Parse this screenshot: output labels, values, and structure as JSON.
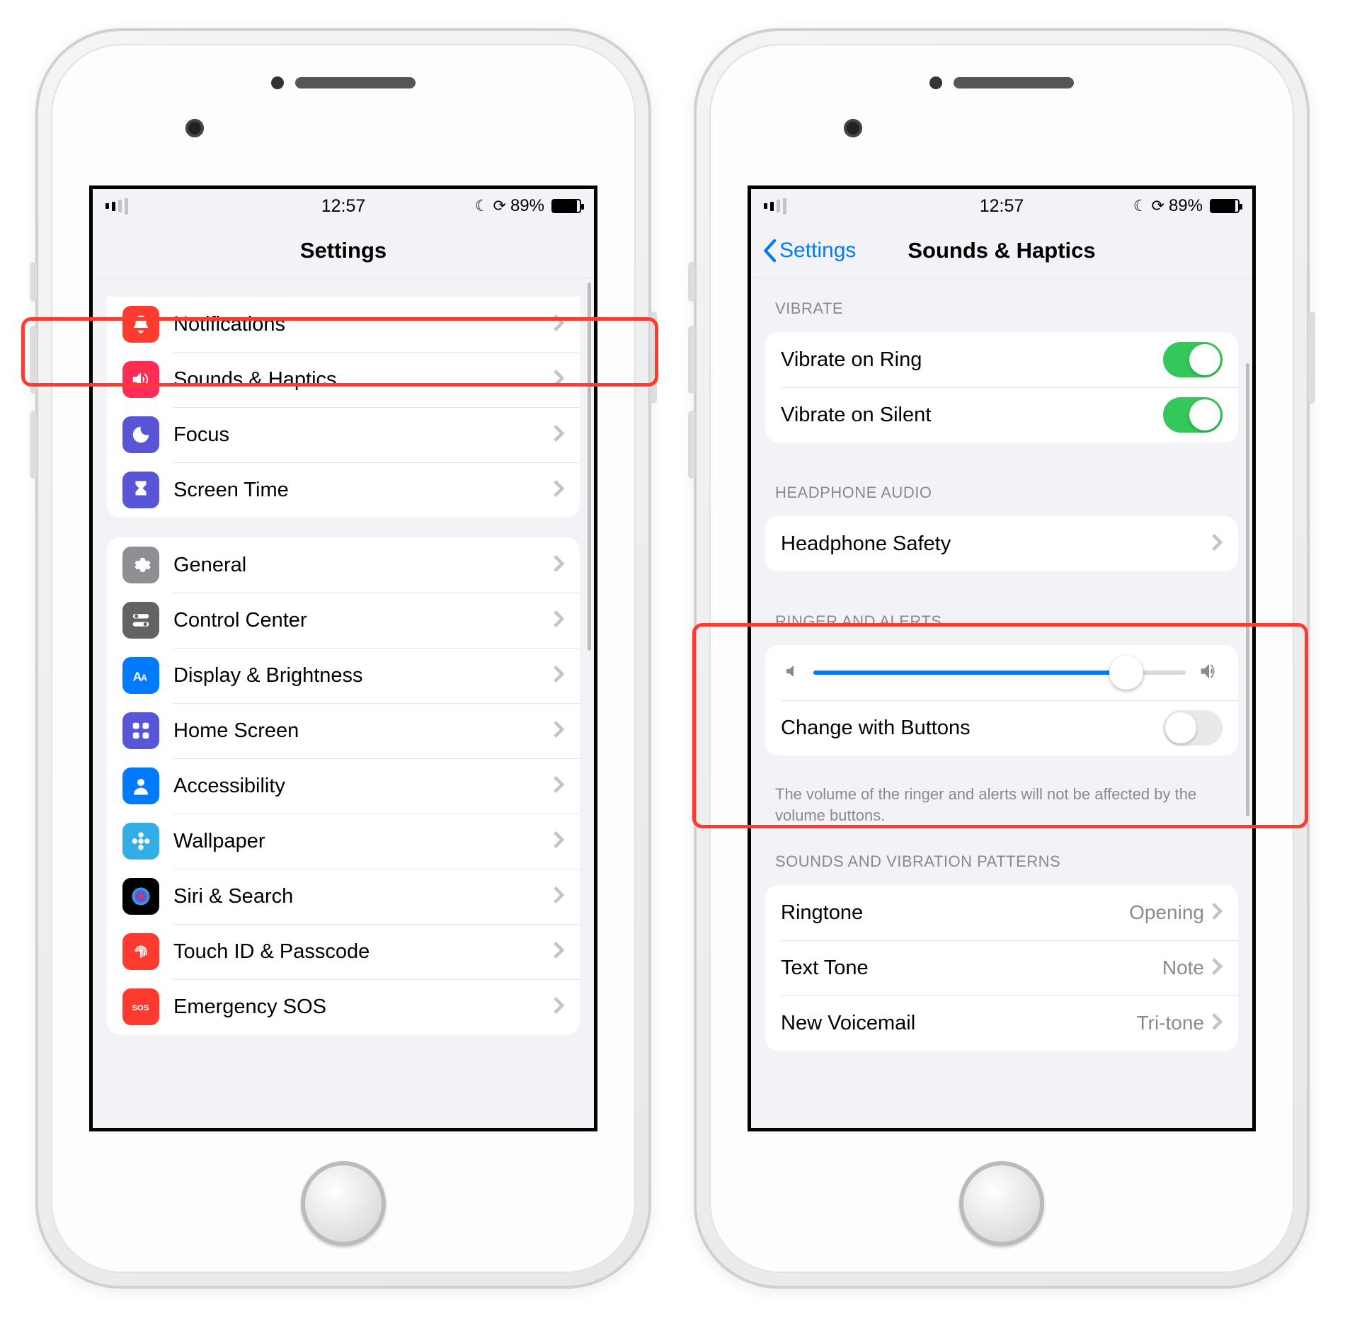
{
  "status": {
    "time": "12:57",
    "battery_pct": "89%"
  },
  "left": {
    "title": "Settings",
    "group1": [
      {
        "label": "Notifications",
        "icon": "bell-icon",
        "color": "ic-red"
      },
      {
        "label": "Sounds & Haptics",
        "icon": "speaker-icon",
        "color": "ic-pink"
      },
      {
        "label": "Focus",
        "icon": "moon-icon",
        "color": "ic-indigo"
      },
      {
        "label": "Screen Time",
        "icon": "hourglass-icon",
        "color": "ic-indigo"
      }
    ],
    "group2": [
      {
        "label": "General",
        "icon": "gear-icon",
        "color": "ic-gray"
      },
      {
        "label": "Control Center",
        "icon": "switches-icon",
        "color": "ic-darkgray"
      },
      {
        "label": "Display & Brightness",
        "icon": "aa-icon",
        "color": "ic-blue"
      },
      {
        "label": "Home Screen",
        "icon": "grid-icon",
        "color": "ic-indigo"
      },
      {
        "label": "Accessibility",
        "icon": "person-icon",
        "color": "ic-blue"
      },
      {
        "label": "Wallpaper",
        "icon": "flower-icon",
        "color": "ic-cyan"
      },
      {
        "label": "Siri & Search",
        "icon": "siri-icon",
        "color": "ic-black"
      },
      {
        "label": "Touch ID & Passcode",
        "icon": "fingerprint-icon",
        "color": "ic-touchid"
      },
      {
        "label": "Emergency SOS",
        "icon": "sos-icon",
        "color": "ic-red"
      }
    ]
  },
  "right": {
    "back": "Settings",
    "title": "Sounds & Haptics",
    "sec_vibrate": "VIBRATE",
    "vibrate_ring": "Vibrate on Ring",
    "vibrate_silent": "Vibrate on Silent",
    "sec_headphone": "HEADPHONE AUDIO",
    "headphone_safety": "Headphone Safety",
    "sec_ringer": "RINGER AND ALERTS",
    "change_buttons": "Change with Buttons",
    "footer": "The volume of the ringer and alerts will not be affected by the volume buttons.",
    "sec_sounds": "SOUNDS AND VIBRATION PATTERNS",
    "ringtone": {
      "label": "Ringtone",
      "value": "Opening"
    },
    "texttone": {
      "label": "Text Tone",
      "value": "Note"
    },
    "voicemail": {
      "label": "New Voicemail",
      "value": "Tri-tone"
    }
  }
}
